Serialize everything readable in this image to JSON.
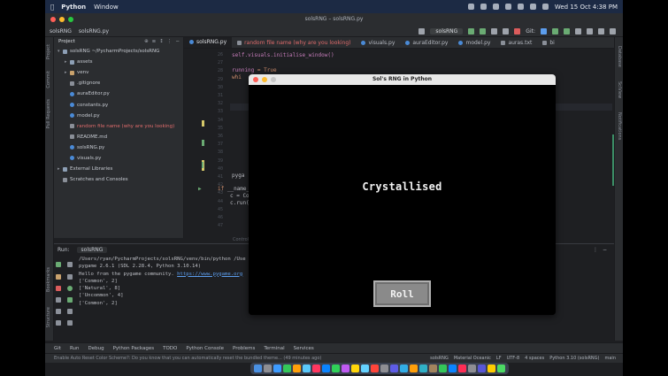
{
  "menubar": {
    "app_name": "Python",
    "menu_window": "Window",
    "clock": "Wed 15 Oct  4:38 PM"
  },
  "ide": {
    "window_title": "solsRNG – solsRNG.py",
    "project_name": "solsRNG",
    "breadcrumb_file": "solsRNG.py",
    "run_config": "solsRNG",
    "git_label": "Git:",
    "colors": {
      "accent": "#3574f0",
      "background": "#1e1f22",
      "panel": "#2b2d30"
    }
  },
  "project_panel": {
    "header": "Project",
    "items": [
      {
        "label": "solsRNG  ~/PycharmProjects/solsRNG",
        "kind": "folder-open",
        "indent": 0
      },
      {
        "label": "assets",
        "kind": "folder",
        "indent": 1
      },
      {
        "label": "venv",
        "kind": "folder-y",
        "indent": 1
      },
      {
        "label": ".gitignore",
        "kind": "txt",
        "indent": 1
      },
      {
        "label": "auraEditor.py",
        "kind": "py",
        "indent": 1
      },
      {
        "label": "constants.py",
        "kind": "py",
        "indent": 1
      },
      {
        "label": "model.py",
        "kind": "py",
        "indent": 1
      },
      {
        "label": "random file name (why are you looking)",
        "kind": "txt",
        "indent": 1
      },
      {
        "label": "README.md",
        "kind": "txt",
        "indent": 1
      },
      {
        "label": "solsRNG.py",
        "kind": "py",
        "indent": 1
      },
      {
        "label": "visuals.py",
        "kind": "py",
        "indent": 1
      },
      {
        "label": "External Libraries",
        "kind": "folder",
        "indent": 0
      },
      {
        "label": "Scratches and Consoles",
        "kind": "txt",
        "indent": 0
      }
    ]
  },
  "editor": {
    "tabs": [
      {
        "label": "solsRNG.py",
        "active": true,
        "red": false
      },
      {
        "label": "random file name (why are you looking)",
        "active": false,
        "red": true
      },
      {
        "label": "visuals.py",
        "active": false,
        "red": false
      },
      {
        "label": "auraEditor.py",
        "active": false,
        "red": false
      },
      {
        "label": "model.py",
        "active": false,
        "red": false
      },
      {
        "label": "auras.txt",
        "active": false,
        "red": false
      },
      {
        "label": "bi",
        "active": false,
        "red": false
      }
    ],
    "line_numbers": [
      "26",
      "27",
      "28",
      "29",
      "30",
      "31",
      "32",
      "33",
      "34",
      "35",
      "36",
      "37",
      "38",
      "39",
      "40",
      "41",
      "42",
      "43",
      "44",
      "45",
      "46",
      "47"
    ],
    "code_lines": {
      "l1": "self.visuals.initialise_window()",
      "l2_kw": "running",
      "l2_rest": " = True",
      "l3": "whi",
      "l4": "pyga",
      "l5_kw": "if",
      "l5_rest": " __name__",
      "l6": "c = Cont",
      "l7": "c.run()"
    },
    "footer": "Controller  >  run()"
  },
  "run_panel": {
    "label": "Run:",
    "tab": "solsRNG",
    "console_lines": [
      "/Users/ryan/PycharmProjects/solsRNG/venv/bin/python /Use",
      "pygame 2.6.1 (SDL 2.28.4, Python 3.10.14)",
      "['Common', 2]",
      "['Natural', 8]",
      "['Uncommon', 4]",
      "['Common', 2]"
    ],
    "hello_prefix": "Hello from the pygame community. ",
    "hello_link": "https://www.pygame.org"
  },
  "bottom_tabs": [
    "Git",
    "Run",
    "Debug",
    "Python Packages",
    "TODO",
    "Python Console",
    "Problems",
    "Terminal",
    "Services"
  ],
  "status_bar": {
    "message": "Enable Auto Reset Color Scheme?: Do you know that you can automatically reset the bundled theme... (49 minutes ago)",
    "right": [
      "solsRNG",
      "Material Oceanic",
      "LF",
      "UTF-8",
      "4 spaces",
      "Python 3.10 (solsRNG)",
      "main"
    ]
  },
  "pygame_window": {
    "title": "Sol's RNG in Python",
    "aura_result": "Crystallised",
    "roll_button": "Roll"
  }
}
